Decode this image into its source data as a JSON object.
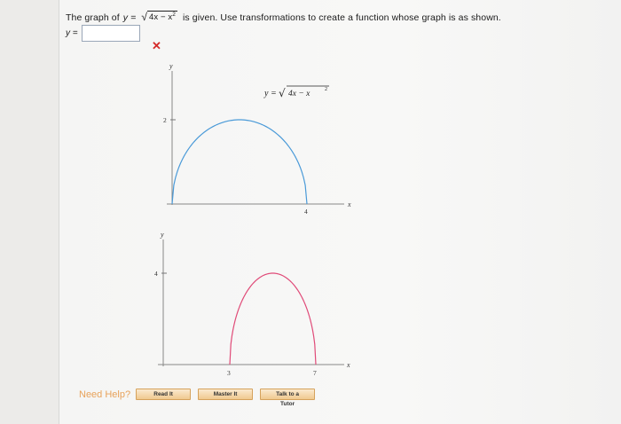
{
  "question": {
    "prefix": "The graph of",
    "y_eq": "y =",
    "radical_sign": "√",
    "radicand_main": "4x − x",
    "radicand_exp": "2",
    "suffix": "is given. Use transformations to create a function whose graph is as shown."
  },
  "answer": {
    "label": "y =",
    "value": "",
    "placeholder": "",
    "status_mark": "✕"
  },
  "graph_top": {
    "y_axis_label": "y",
    "x_axis_label": "x",
    "y_tick": "2",
    "x_tick": "4",
    "equation_prefix": "y = ",
    "equation_radical": "√",
    "equation_radicand": "4x − x",
    "equation_exp": "2"
  },
  "graph_bottom": {
    "y_axis_label": "y",
    "x_axis_label": "x",
    "y_tick": "4",
    "x_tick_left": "3",
    "x_tick_right": "7"
  },
  "chart_data": [
    {
      "type": "line",
      "function": "y = sqrt(4x - x^2)",
      "x_domain": [
        0,
        4
      ],
      "y_max": 2,
      "color": "#4a9ad8",
      "xlabel": "x",
      "ylabel": "y"
    },
    {
      "type": "line",
      "x_domain": [
        3,
        7
      ],
      "y_max": 4,
      "color": "#e04a78",
      "xlabel": "x",
      "ylabel": "y"
    }
  ],
  "help": {
    "label": "Need Help?",
    "buttons": [
      "Read It",
      "Master It",
      "Talk to a Tutor"
    ]
  }
}
